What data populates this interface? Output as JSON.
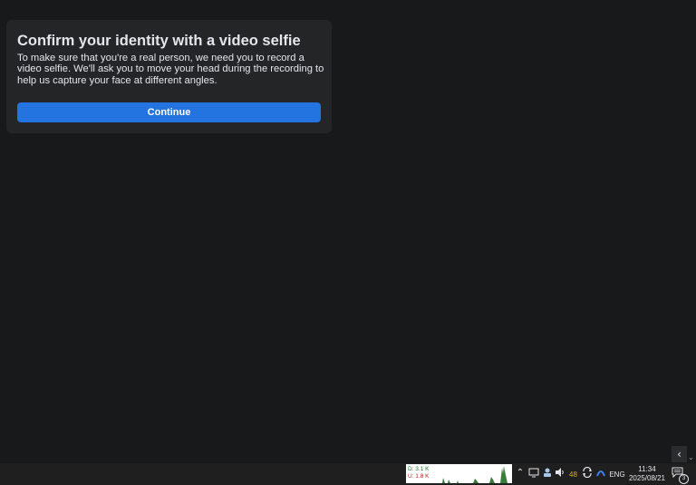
{
  "dialog": {
    "title": "Confirm your identity with a video selfie",
    "body": "To make sure that you're a real person, we need you to record a video selfie. We'll ask you to move your head during the recording to help us capture your face at different angles.",
    "continue_label": "Continue",
    "accent_color": "#2374e1"
  },
  "taskbar": {
    "network": {
      "download": "D: 3.1 K",
      "upload": "U: 1.8 K"
    },
    "tray": {
      "show_hidden_icon": "chevron-up-icon",
      "temperature": "48",
      "language": "ENG"
    },
    "clock": {
      "time": "11:34",
      "date": "2025/08/21"
    },
    "notifications": {
      "count": "3"
    }
  }
}
